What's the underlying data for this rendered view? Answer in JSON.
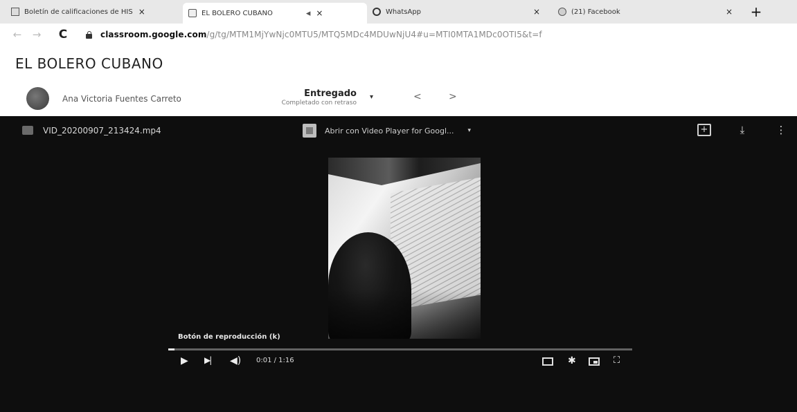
{
  "browser": {
    "tabs": [
      {
        "title": "Boletín de calificaciones de HIS",
        "close": "×"
      },
      {
        "title": "EL BOLERO CUBANO",
        "extra": "◂",
        "close": "×"
      },
      {
        "title": "WhatsApp",
        "close": "×"
      },
      {
        "title": "(21) Facebook",
        "close": "×"
      }
    ],
    "new_tab": "+",
    "nav": {
      "back": "←",
      "forward": "→",
      "reload": "C"
    },
    "url_host": "classroom.google.com",
    "url_path": "/g/tg/MTM1MjYwNjc0MTU5/MTQ5MDc4MDUwNjU4#u=MTI0MTA1MDc0OTI5&t=f"
  },
  "page": {
    "title": "EL BOLERO CUBANO",
    "student": {
      "name": "Ana Victoria Fuentes Carreto",
      "status": "Entregado",
      "status_sub": "Completado con retraso",
      "dropdown": "▾",
      "prev": "<",
      "next": ">"
    }
  },
  "viewer": {
    "file_name": "VID_20200907_213424.mp4",
    "open_with": "Abrir con Video Player for Googl...",
    "open_with_caret": "▾",
    "icons": {
      "add_to_drive": "+",
      "download": "⤓",
      "more": "⋮"
    },
    "tooltip": "Botón de reproducción (k)",
    "player": {
      "play": "▶",
      "next": "▶|",
      "volume": "◀)",
      "time": "0:01 / 1:16",
      "progress": 0.013,
      "settings": "✱",
      "fullscreen": "⛶"
    }
  }
}
